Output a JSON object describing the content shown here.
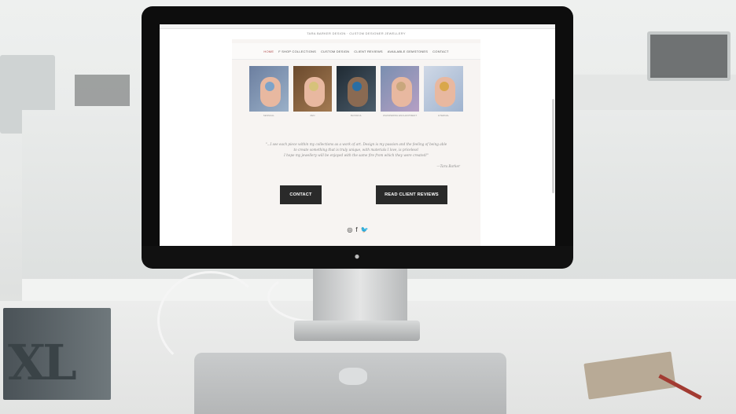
{
  "site": {
    "brand": "TARA BARKER DESIGN · CUSTOM DESIGNER JEWELLERY",
    "nav": [
      "HOME",
      "F SHOP COLLECTIONS",
      "CUSTOM DESIGN",
      "CLIENT REVIEWS",
      "AVAILABLE GEMSTONES",
      "CONTACT"
    ],
    "active_nav": "HOME",
    "thumbnails": [
      {
        "caption": "SENSUAL",
        "ring_color": "#7da3c9"
      },
      {
        "caption": "ZEN",
        "ring_color": "#d6c27a"
      },
      {
        "caption": "BLISSFUL",
        "ring_color": "#2a6ea3"
      },
      {
        "caption": "WHISPERING ENCHANTMENT",
        "ring_color": "#c9a77d"
      },
      {
        "caption": "ETERNAL",
        "ring_color": "#d9a74a"
      }
    ],
    "quote": {
      "line1": "\"...I see each piece within my collections as a work of art. Design is my passion and the feeling of being able",
      "line2": "to create something that is truly unique, with materials I love, is priceless!",
      "line3": "I hope my jewellery will be enjoyed with the same fire from which they were created!\"",
      "author": "—Tara Barker"
    },
    "buttons": {
      "contact": "CONTACT",
      "reviews": "READ CLIENT REVIEWS"
    },
    "social": {
      "instagram": "◎",
      "facebook": "f",
      "twitter": "🐦"
    }
  },
  "scene": {
    "book_text": "XL"
  }
}
